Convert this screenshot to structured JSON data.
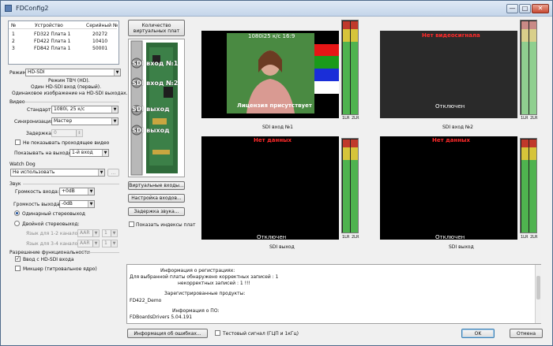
{
  "window": {
    "title": "FDConfig2",
    "min": "—",
    "max": "□",
    "close": "✕"
  },
  "devices": {
    "headers": [
      "№",
      "Устройство",
      "Серийный №"
    ],
    "rows": [
      [
        "1",
        "FD322 Плата 1",
        "20272"
      ],
      [
        "2",
        "FD422 Плата 1",
        "10410"
      ],
      [
        "3",
        "FD842 Плата 1",
        "50001"
      ]
    ]
  },
  "mode": {
    "label": "Режим:",
    "value": "HD-SDI",
    "desc1": "Режим ТВЧ (HD).",
    "desc2": "Один HD-SDI вход (первый).",
    "desc3": "Одинаковое изображение на HD-SDI выходах."
  },
  "video": {
    "group": "Видео",
    "standard_label": "Стандарт:",
    "standard_value": "1080i, 25 к/с",
    "sync_label": "Синхронизация:",
    "sync_value": "Мастер",
    "delay_label": "Задержка:",
    "delay_value": "0",
    "passthrough_label": "Не показывать проходящее видео",
    "show_output_label": "Показывать на выходе:",
    "show_output_value": "1-й вход"
  },
  "watchdog": {
    "group": "Watch Dog",
    "value": "Не использовать",
    "more": "..."
  },
  "sound": {
    "group": "Звук",
    "input_vol_label": "Громкость входа:",
    "input_vol_value": "+0dB",
    "output_vol_label": "Громкость выхода:",
    "output_vol_value": "-0dB",
    "single_stereo": "Одинарный стереовыход",
    "double_stereo": "Двойной стереовыход:",
    "lang12_label": "Язык для 1-2 каналов:",
    "lang12_value": "AAR",
    "lang12_num": "1",
    "lang34_label": "Язык для 3-4 каналов:",
    "lang34_value": "AAR",
    "lang34_num": "1"
  },
  "functions": {
    "group": "Разрешение функциональности",
    "hdsdi_input": "Ввод с HD-SDI входа",
    "mixer": "Микшер (титровальное ядро)"
  },
  "card": {
    "virtual_btn": "Количество виртуальных плат",
    "labels": [
      "SDI вход №1",
      "SDI вход №2",
      "SDI выход",
      "SDI выход"
    ]
  },
  "side_buttons": {
    "virtual_inputs": "Виртуальные входы...",
    "input_settings": "Настройка входов...",
    "audio_delay": "Задержка звука...",
    "show_indexes": "Показать индексы плат"
  },
  "monitors": [
    {
      "caption": "SDI вход №1",
      "overlay_top": "1080i25 к/с 16:9",
      "overlay_bottom": "Лицензия присутствует"
    },
    {
      "caption": "SDI вход №2",
      "overlay_top": "Нет видеосигнала",
      "overlay_bottom": "Отключен"
    },
    {
      "caption": "SDI выход",
      "overlay_top": "Нет данных",
      "overlay_bottom": "Отключен"
    },
    {
      "caption": "SDI выход",
      "overlay_top": "Нет данных",
      "overlay_bottom": "Отключен"
    }
  ],
  "vu_labels": [
    "1LR",
    "2LR"
  ],
  "info_log": [
    "Информация о регистрациях:",
    "Для выбранной платы обнаружено корректных записей : 1",
    "некорректных записей : 1 !!!",
    "Зарегистрированные продукты:",
    "FD422_Demo",
    "Информация о ПО:",
    "FDBoardsDrivers 5.04.191"
  ],
  "bottom": {
    "errors_btn": "Информация об ошибках...",
    "test_signal": "Тестовый сигнал (ГЦП и 1кГц)",
    "ok": "OK",
    "cancel": "Отмена"
  },
  "colors": {
    "accent": "#1d4f9a",
    "vu_green": "#4fb34f",
    "vu_yellow": "#d6c43a",
    "vu_red": "#c0392b",
    "alarm_text": "#ff2a2a"
  }
}
